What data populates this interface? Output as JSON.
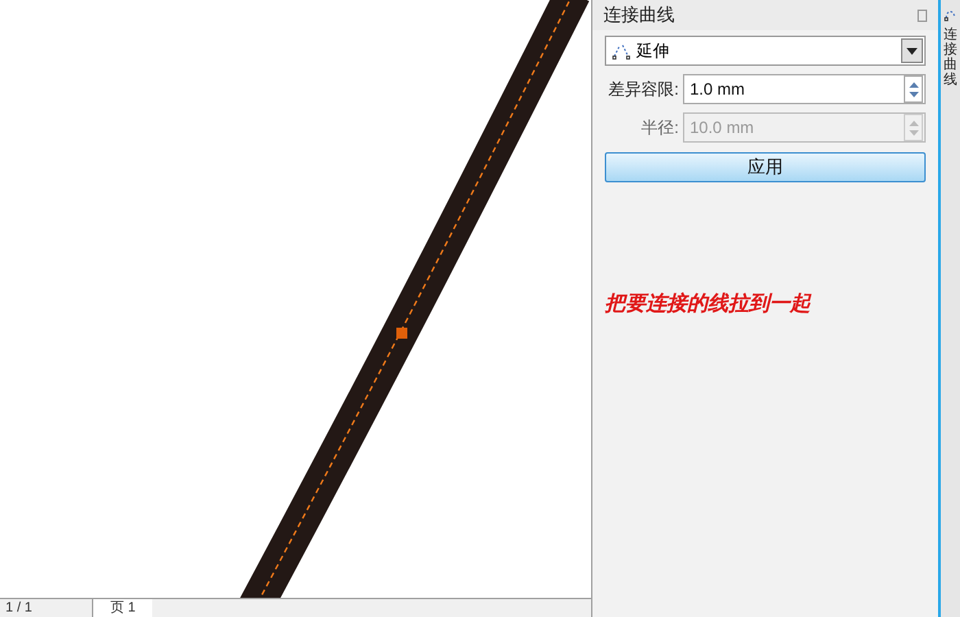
{
  "docker": {
    "title": "连接曲线",
    "mode": {
      "value": "延伸"
    },
    "fields": [
      {
        "label": "差异容限:",
        "value": "1.0 mm",
        "disabled": false
      },
      {
        "label": "半径:",
        "value": "10.0 mm",
        "disabled": true
      }
    ],
    "apply_button": "应用",
    "annotation": "把要连接的线拉到一起"
  },
  "side_tab": {
    "label": "连接曲线"
  },
  "status_bar": {
    "page_count": "1 / 1",
    "page_tab": "页 1"
  }
}
